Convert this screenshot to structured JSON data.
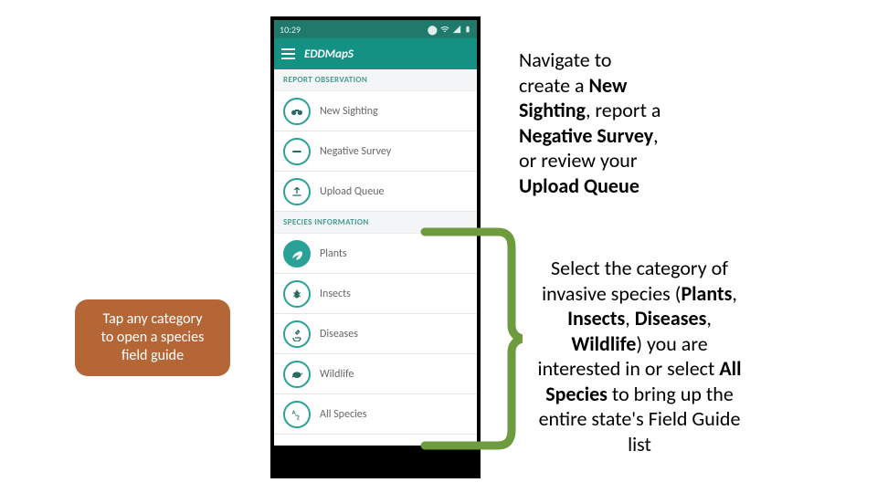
{
  "phone": {
    "status_time": "10:29",
    "app_name": "EDDMapS",
    "section1_title": "REPORT OBSERVATION",
    "section2_title": "SPECIES INFORMATION",
    "items1": [
      {
        "label": "New Sighting"
      },
      {
        "label": "Negative Survey"
      },
      {
        "label": "Upload Queue"
      }
    ],
    "items2": [
      {
        "label": "Plants"
      },
      {
        "label": "Insects"
      },
      {
        "label": "Diseases"
      },
      {
        "label": "Wildlife"
      },
      {
        "label": "All Species"
      }
    ]
  },
  "left_callout": {
    "line1": "Tap any category",
    "line2": "to open a species",
    "line3": "field guide"
  },
  "top_right": {
    "t1": "Navigate to",
    "t2": "create a ",
    "b1": "New",
    "b2": "Sighting",
    "t3": ", report a",
    "b3": "Negative Survey",
    "t4": ",",
    "t5": "or review your",
    "b4": "Upload Queue"
  },
  "bottom_right": {
    "t1": "Select the category of",
    "t2": "invasive species (",
    "b1": "Plants",
    "t3": ",",
    "b2": "Insects",
    "t4": ", ",
    "b3": "Diseases",
    "t5": ",",
    "b4": "Wildlife",
    "t6": ") you are",
    "t7": "interested in or select ",
    "b5": "All",
    "b6": "Species",
    "t8": " to bring up the",
    "t9": "entire state's Field Guide",
    "t10": "list"
  }
}
